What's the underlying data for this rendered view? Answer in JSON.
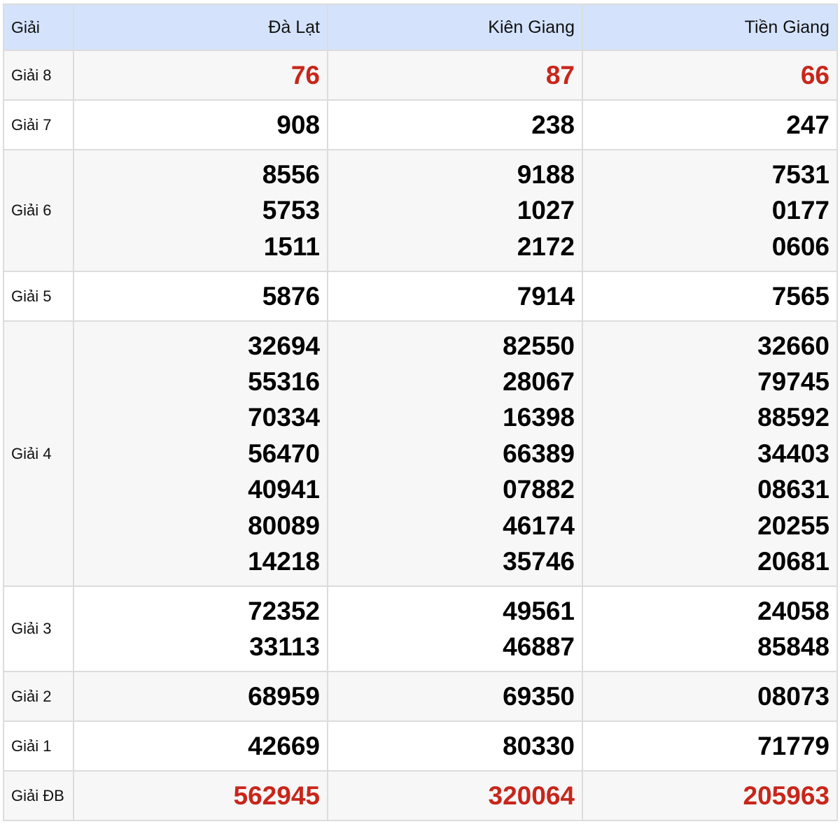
{
  "header": {
    "label": "Giải",
    "provinces": [
      "Đà Lạt",
      "Kiên Giang",
      "Tiền Giang"
    ]
  },
  "rows": [
    {
      "label": "Giải 8",
      "highlight": true,
      "values": [
        [
          "76"
        ],
        [
          "87"
        ],
        [
          "66"
        ]
      ]
    },
    {
      "label": "Giải 7",
      "values": [
        [
          "908"
        ],
        [
          "238"
        ],
        [
          "247"
        ]
      ]
    },
    {
      "label": "Giải 6",
      "values": [
        [
          "8556",
          "5753",
          "1511"
        ],
        [
          "9188",
          "1027",
          "2172"
        ],
        [
          "7531",
          "0177",
          "0606"
        ]
      ]
    },
    {
      "label": "Giải 5",
      "values": [
        [
          "5876"
        ],
        [
          "7914"
        ],
        [
          "7565"
        ]
      ]
    },
    {
      "label": "Giải 4",
      "values": [
        [
          "32694",
          "55316",
          "70334",
          "56470",
          "40941",
          "80089",
          "14218"
        ],
        [
          "82550",
          "28067",
          "16398",
          "66389",
          "07882",
          "46174",
          "35746"
        ],
        [
          "32660",
          "79745",
          "88592",
          "34403",
          "08631",
          "20255",
          "20681"
        ]
      ]
    },
    {
      "label": "Giải 3",
      "values": [
        [
          "72352",
          "33113"
        ],
        [
          "49561",
          "46887"
        ],
        [
          "24058",
          "85848"
        ]
      ]
    },
    {
      "label": "Giải 2",
      "values": [
        [
          "68959"
        ],
        [
          "69350"
        ],
        [
          "08073"
        ]
      ]
    },
    {
      "label": "Giải 1",
      "values": [
        [
          "42669"
        ],
        [
          "80330"
        ],
        [
          "71779"
        ]
      ]
    },
    {
      "label": "Giải ĐB",
      "highlight": true,
      "values": [
        [
          "562945"
        ],
        [
          "320064"
        ],
        [
          "205963"
        ]
      ]
    }
  ],
  "colors": {
    "header_bg": "#d4e3fb",
    "highlight": "#c8261b",
    "alt_row": "#f7f7f7"
  }
}
